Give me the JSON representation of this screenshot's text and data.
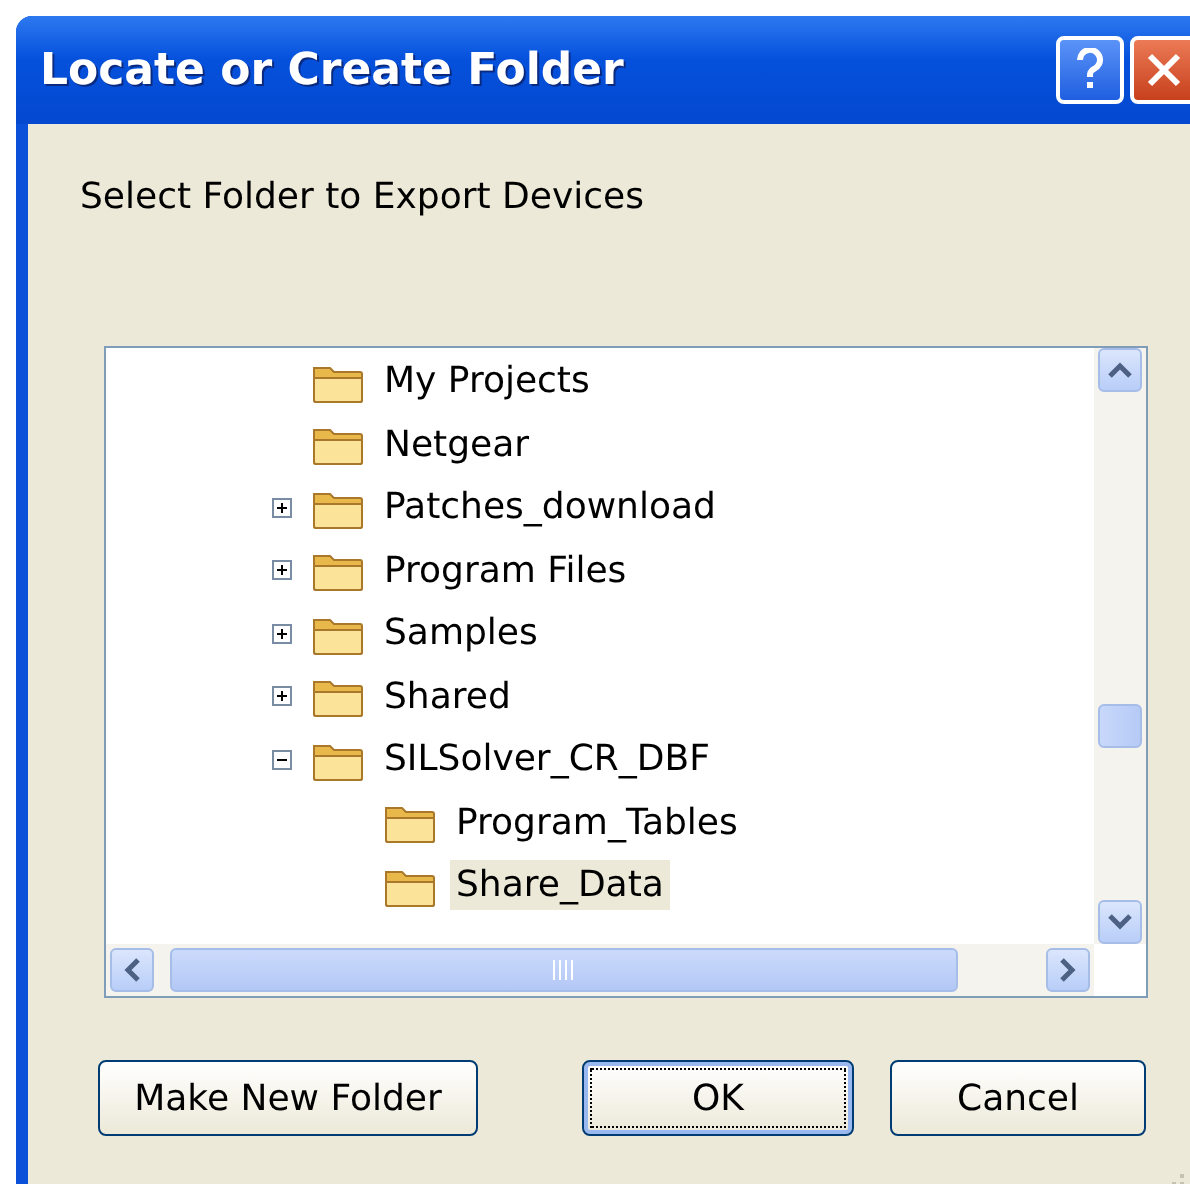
{
  "window": {
    "title": "Locate or Create Folder"
  },
  "prompt": "Select Folder to Export Devices",
  "tree": [
    {
      "label": "My Projects",
      "selected": false
    },
    {
      "label": "Netgear",
      "selected": false
    },
    {
      "label": "Patches_download",
      "selected": false,
      "expanded": false
    },
    {
      "label": "Program Files",
      "selected": false,
      "expanded": false
    },
    {
      "label": "Samples",
      "selected": false,
      "expanded": false
    },
    {
      "label": "Shared",
      "selected": false,
      "expanded": false
    },
    {
      "label": "SILSolver_CR_DBF",
      "selected": false,
      "expanded": true,
      "children": [
        {
          "label": "Program_Tables",
          "selected": false
        },
        {
          "label": "Share_Data",
          "selected": true
        }
      ]
    }
  ],
  "buttons": [
    {
      "label": "Make New Folder",
      "focused": false
    },
    {
      "label": "OK",
      "focused": true
    },
    {
      "label": "Cancel",
      "focused": false
    }
  ]
}
